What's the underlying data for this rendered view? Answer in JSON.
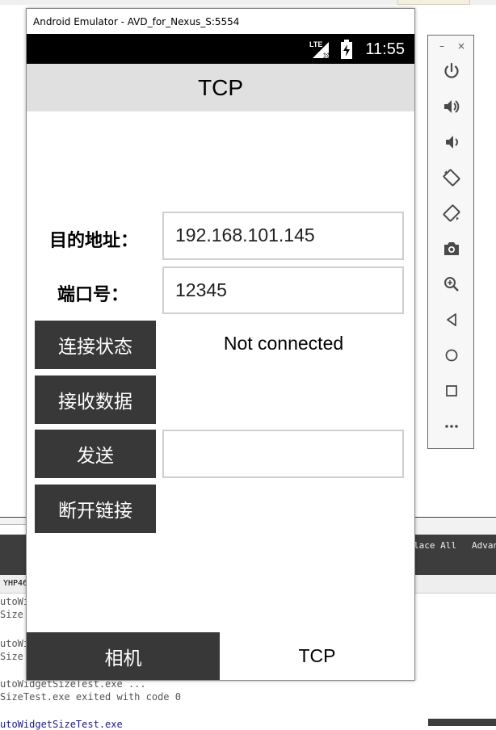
{
  "emulator": {
    "window_title": "Android Emulator - AVD_for_Nexus_S:5554",
    "status_bar": {
      "network": "LTE",
      "time": "11:55"
    }
  },
  "app": {
    "title": "TCP",
    "form": {
      "address_label": "目的地址：",
      "address_value": "192.168.101.145",
      "port_label": "端口号：",
      "port_value": "12345",
      "send_value": ""
    },
    "buttons": {
      "connection_status": "连接状态",
      "receive_data": "接收数据",
      "send": "发送",
      "disconnect": "断开链接"
    },
    "connection_status_text": "Not connected",
    "bottom_nav": [
      {
        "label": "相机",
        "selected": true
      },
      {
        "label": "TCP",
        "selected": false
      }
    ]
  },
  "side_panel": {
    "window_buttons": {
      "minimize": "–",
      "close": "×"
    },
    "controls": [
      "power-icon",
      "volume-up-icon",
      "volume-down-icon",
      "rotate-left-icon",
      "rotate-right-icon",
      "camera-icon",
      "zoom-icon",
      "back-icon",
      "home-icon",
      "overview-icon",
      "more-icon"
    ]
  },
  "ide": {
    "find_bar": [
      "lace All",
      "Advan"
    ],
    "output_tab": "YHP46",
    "output_lines": [
      "utoWi",
      "Size",
      "utoWi",
      "Size",
      "utoWidgetSizeTest.exe ...",
      "SizeTest.exe exited with code 0",
      "utoWidgetSizeTest.exe"
    ]
  },
  "colors": {
    "button_bg": "#383838",
    "action_bar_bg": "#e0e0e0",
    "status_bar_bg": "#000000"
  }
}
